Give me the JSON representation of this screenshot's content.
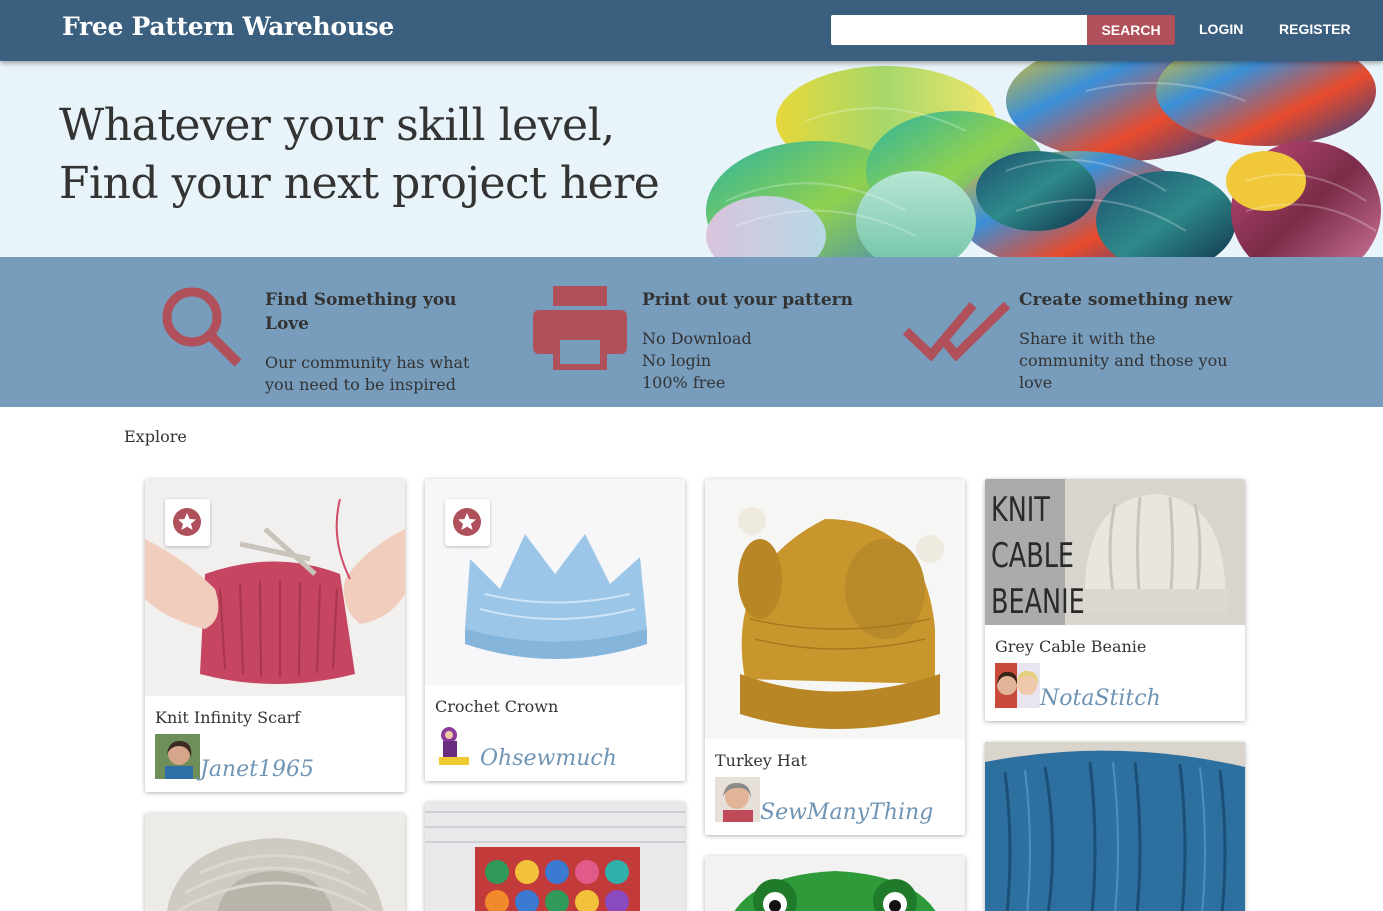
{
  "navbar": {
    "brand": "Free Pattern Warehouse",
    "search_placeholder": "",
    "search_label": "SEARCH",
    "login_label": "LOGIN",
    "register_label": "REGISTER"
  },
  "hero": {
    "line1": "Whatever your skill level,",
    "line2": "Find your next project here"
  },
  "features": [
    {
      "icon": "search-icon",
      "title_line1": "Find Something you",
      "title_line2": "Love",
      "text_line1": "Our community has what",
      "text_line2": "you need to be inspired",
      "text_line3": ""
    },
    {
      "icon": "printer-icon",
      "title_line1": "Print out your pattern",
      "title_line2": "",
      "text_line1": "No Download",
      "text_line2": "No login",
      "text_line3": "100% free"
    },
    {
      "icon": "double-check-icon",
      "title_line1": "Create something new",
      "title_line2": "",
      "text_line1": "Share it with the",
      "text_line2": "community and those you",
      "text_line3": "love"
    }
  ],
  "explore_label": "Explore",
  "cards": [
    {
      "title": "Knit Infinity Scarf",
      "author": "Janet1965",
      "favorite": true
    },
    {
      "title": "Crochet Crown",
      "author": "Ohsewmuch",
      "favorite": true
    },
    {
      "title": "Turkey Hat",
      "author": "SewManyThing",
      "favorite": false
    },
    {
      "title": "Grey Cable Beanie",
      "author": "NotaStitch",
      "favorite": false,
      "image_text": [
        "KNIT",
        "CABLE",
        "BEANIE"
      ]
    }
  ],
  "colors": {
    "navbar": "#3b5f7e",
    "accent": "#b0505a",
    "hero_bg": "#e8f3fa",
    "features_bg": "#779cbc",
    "author_link": "#6f94b4"
  }
}
